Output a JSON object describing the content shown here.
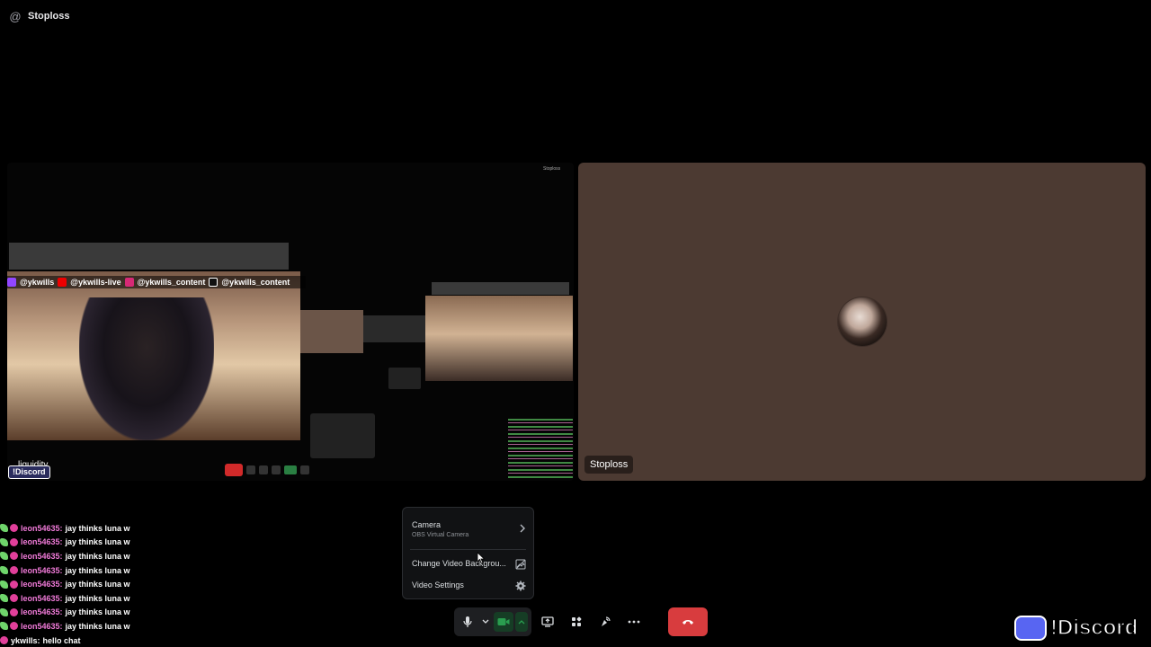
{
  "header": {
    "channel_name": "Stoploss"
  },
  "participants": {
    "screenshare": {
      "overlay": {
        "social_links": [
          "@ykwills",
          "@ykwills-live",
          "@ykwills_content",
          "@ykwills_content"
        ],
        "caption": "liquidity"
      }
    },
    "user": {
      "name": "Stoploss",
      "tile_color": "#4c3a32"
    }
  },
  "popup_menu": {
    "camera": {
      "label": "Camera",
      "device": "OBS Virtual Camera"
    },
    "change_background": {
      "label": "Change Video Backgrou..."
    },
    "video_settings": {
      "label": "Video Settings"
    }
  },
  "controls": {
    "microphone": {
      "icon": "microphone-icon"
    },
    "mic_options": {
      "icon": "chevron-down-icon"
    },
    "camera": {
      "icon": "camera-icon",
      "active": true
    },
    "camera_options": {
      "icon": "chevron-up-icon"
    },
    "share_screen": {
      "icon": "screen-share-icon"
    },
    "activities": {
      "icon": "activities-icon"
    },
    "soundboard": {
      "icon": "soundboard-icon"
    },
    "more": {
      "icon": "more-icon"
    },
    "disconnect": {
      "icon": "phone-hangup-icon",
      "color": "#d83c3e"
    }
  },
  "chat": [
    {
      "user": "leon54635:",
      "message": "jay thinks luna w"
    },
    {
      "user": "leon54635:",
      "message": "jay thinks luna w"
    },
    {
      "user": "leon54635:",
      "message": "jay thinks luna w"
    },
    {
      "user": "leon54635:",
      "message": "jay thinks luna w"
    },
    {
      "user": "leon54635:",
      "message": "jay thinks luna w"
    },
    {
      "user": "leon54635:",
      "message": "jay thinks luna w"
    },
    {
      "user": "leon54635:",
      "message": "jay thinks luna w"
    },
    {
      "user": "leon54635:",
      "message": "jay thinks luna w"
    },
    {
      "user": "ykwills:",
      "message": "hello chat"
    }
  ],
  "watermark": {
    "text": "!Discord"
  },
  "colors": {
    "accent_green": "#2a9d4f",
    "danger": "#d83c3e",
    "menu_bg": "#111214"
  }
}
